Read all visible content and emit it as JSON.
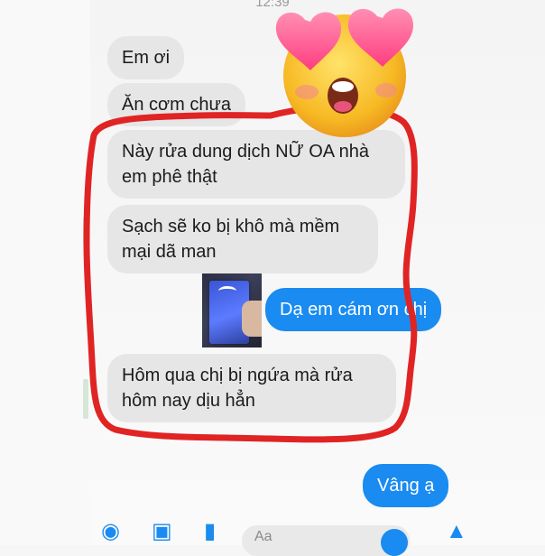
{
  "status_bar": {
    "time": "12:39"
  },
  "messages": [
    {
      "id": "m1",
      "dir": "in",
      "text": "Em ơi"
    },
    {
      "id": "m2",
      "dir": "in",
      "text": "Ăn cơm chưa"
    },
    {
      "id": "m3",
      "dir": "in",
      "lines": [
        "Này rửa dung dịch NỮ OA nhà",
        "em phê thật"
      ]
    },
    {
      "id": "m4",
      "dir": "in",
      "lines": [
        "Sạch sẽ ko bị khô mà mềm",
        "mại dã man"
      ]
    },
    {
      "id": "m5",
      "dir": "out",
      "text": "Dạ em cám ơn chị"
    },
    {
      "id": "m6",
      "dir": "in",
      "lines": [
        "Hôm qua chị bị ngứa mà rửa",
        "hôm nay dịu hẳn"
      ]
    },
    {
      "id": "m7",
      "dir": "out",
      "text": "Vâng ạ"
    }
  ],
  "colors": {
    "incoming_bubble": "#e6e6e6",
    "outgoing_bubble": "#1a8bf0",
    "annotation": "#e02424",
    "accent": "#1a8bf0"
  },
  "icons": {
    "sticker": "heart-eyes-emoji-icon",
    "bar": [
      "camera-icon",
      "image-icon",
      "microphone-icon",
      "emoji-icon",
      "like-icon"
    ]
  },
  "composer": {
    "placeholder": "Aa"
  }
}
